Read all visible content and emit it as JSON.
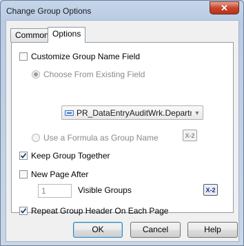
{
  "window": {
    "title": "Change Group Options",
    "close_glyph": "✕"
  },
  "tabs": [
    {
      "label": "Common"
    },
    {
      "label": "Options"
    }
  ],
  "options": {
    "customize_group_name": {
      "label": "Customize Group Name Field",
      "checked": false
    },
    "choose_existing": {
      "label": "Choose From Existing Field",
      "selected": true,
      "enabled": false
    },
    "existing_field_value": "PR_DataEntryAuditWrk.Departmer",
    "use_formula": {
      "label": "Use a Formula as Group Name",
      "selected": false,
      "enabled": false
    },
    "formula_icon_text": "X-2",
    "keep_together": {
      "label": "Keep Group Together",
      "checked": true
    },
    "new_page_after": {
      "label": "New Page After",
      "checked": false
    },
    "visible_groups_value": "1",
    "visible_groups_label": "Visible Groups",
    "repeat_header": {
      "label": "Repeat Group Header On Each Page",
      "checked": true
    }
  },
  "buttons": {
    "ok": "OK",
    "cancel": "Cancel",
    "help": "Help"
  }
}
